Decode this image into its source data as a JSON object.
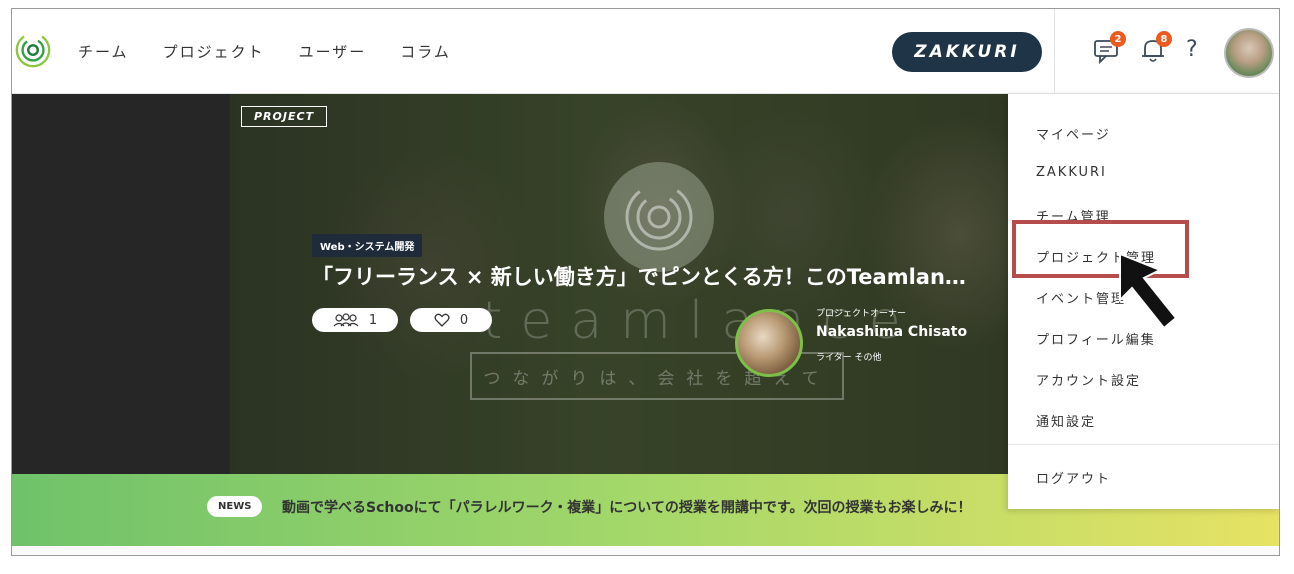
{
  "header": {
    "nav": [
      "チーム",
      "プロジェクト",
      "ユーザー",
      "コラム"
    ],
    "zakkuri_button": "ZAKKURI",
    "messages_badge": "2",
    "notifications_badge": "8",
    "help_label": "?"
  },
  "hero": {
    "project_tag": "PROJECT",
    "category": "Web・システム開発",
    "title": "「フリーランス × 新しい働き方」でピンとくる方！このTeamlan…",
    "members_count": "1",
    "likes_count": "0",
    "watermark": "teamlance",
    "tagline": "つながりは、会社を超えて",
    "owner_label": "プロジェクトオーナー",
    "owner_name": "Nakashima Chisato",
    "owner_role": "ライター その他"
  },
  "news": {
    "tag": "NEWS",
    "text": "動画で学べるSchooにて「パラレルワーク・複業」についての授業を開講中です。次回の授業もお楽しみに！"
  },
  "dropdown": {
    "items": [
      "マイページ",
      "ZAKKURI",
      "チーム管理",
      "プロジェクト管理",
      "イベント管理",
      "プロフィール編集",
      "アカウント設定",
      "通知設定"
    ],
    "logout": "ログアウト"
  },
  "colors": {
    "brand_navy": "#1f3446",
    "badge_orange": "#ec5a1e",
    "highlight_red": "#b64c4c",
    "news_gradient_start": "#6fc26a",
    "news_gradient_end": "#e6e264"
  }
}
